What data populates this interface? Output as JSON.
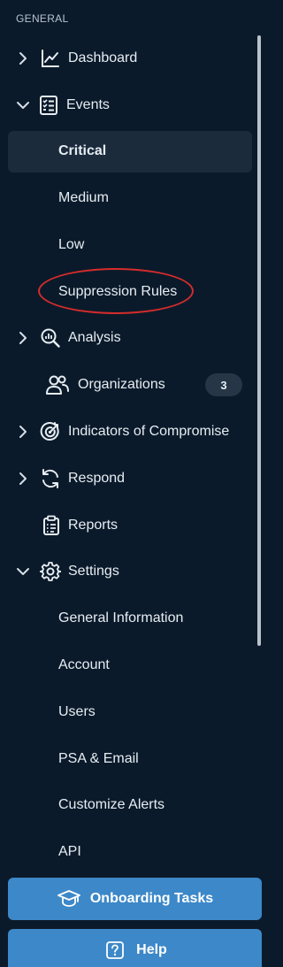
{
  "section": {
    "title": "GENERAL"
  },
  "nav": {
    "dashboard": {
      "label": "Dashboard",
      "icon": "line-chart-icon"
    },
    "events": {
      "label": "Events",
      "icon": "checklist-icon",
      "children": {
        "critical": "Critical",
        "medium": "Medium",
        "low": "Low",
        "suppression": "Suppression Rules"
      }
    },
    "analysis": {
      "label": "Analysis",
      "icon": "magnify-chart-icon"
    },
    "organizations": {
      "label": "Organizations",
      "badge": "3",
      "icon": "people-icon"
    },
    "ioc": {
      "label": "Indicators of Compromise",
      "icon": "target-icon"
    },
    "respond": {
      "label": "Respond",
      "icon": "refresh-icon"
    },
    "reports": {
      "label": "Reports",
      "icon": "clipboard-icon"
    },
    "settings": {
      "label": "Settings",
      "icon": "gear-icon",
      "children": {
        "general_info": "General Information",
        "account": "Account",
        "users": "Users",
        "psa_email": "PSA & Email",
        "customize_alerts": "Customize Alerts",
        "api": "API"
      }
    }
  },
  "buttons": {
    "onboarding": {
      "label": "Onboarding Tasks",
      "icon": "graduation-cap-icon"
    },
    "help": {
      "label": "Help",
      "icon": "question-box-icon"
    }
  },
  "colors": {
    "background": "#0b1a2a",
    "active_item": "#1b2b3c",
    "button": "#3d88c8",
    "highlight": "#d42c2c"
  }
}
